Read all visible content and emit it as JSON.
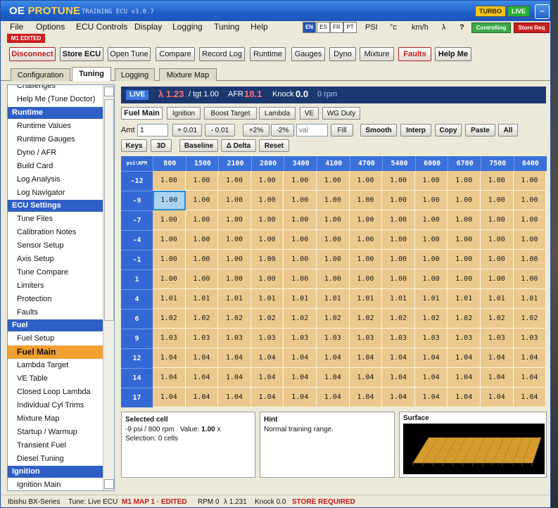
{
  "app": {
    "title_prefix": "OE ",
    "title_brand": "PROTUNE",
    "subtitle": "TRAINING ECU v3.0.7",
    "turbo_badge": "TURBO",
    "live_badge": "LIVE",
    "minimize_glyph": "–"
  },
  "menu": [
    "File",
    "Options",
    "ECU Controls",
    "Display",
    "Logging",
    "Tuning",
    "Help"
  ],
  "languages": [
    {
      "code": "EN",
      "active": true
    },
    {
      "code": "ES",
      "active": false
    },
    {
      "code": "FR",
      "active": false
    },
    {
      "code": "PT",
      "active": false
    }
  ],
  "units": {
    "pressure": "PSI",
    "temp": "°c",
    "speed": "km/h",
    "lambda": "λ",
    "help": "?"
  },
  "status_badges": {
    "controlling": "Controlling",
    "store_req": "Store Req",
    "map_edited": "M1 EDITED"
  },
  "toolbar": [
    "Disconnect",
    "Store ECU",
    "Open Tune",
    "Compare",
    "Record Log",
    "Runtime",
    "Gauges",
    "Dyno",
    "Mixture",
    "Faults",
    "Help Me"
  ],
  "tabs": [
    "Configuration",
    "Tuning",
    "Logging",
    "Mixture Map"
  ],
  "active_tab": "Tuning",
  "sidebar": {
    "top_items": [
      "Challenges",
      "Help Me (Tune Doctor)"
    ],
    "sections": [
      {
        "header": "Runtime",
        "items": [
          "Runtime Values",
          "Runtime Gauges",
          "Dyno / AFR",
          "Build Card",
          "Log Analysis",
          "Log Navigator"
        ]
      },
      {
        "header": "ECU Settings",
        "items": [
          "Tune Files",
          "Calibration Notes",
          "Sensor Setup",
          "Axis Setup",
          "Tune Compare",
          "Limiters",
          "Protection",
          "Faults"
        ]
      },
      {
        "header": "Fuel",
        "items": [
          "Fuel Setup",
          "Fuel Main",
          "Lambda Target",
          "VE Table",
          "Closed Loop Lambda",
          "Individual Cyl Trims",
          "Mixture Map",
          "Startup / Warmup",
          "Transient Fuel",
          "Diesel Tuning"
        ]
      },
      {
        "header": "Ignition",
        "items": [
          "Ignition Main"
        ]
      }
    ],
    "selected": "Fuel Main"
  },
  "live": {
    "badge": "LIVE",
    "lambda_symbol": "λ",
    "lambda_value": "1.23",
    "lambda_target": "/ tgt 1.00",
    "afr_label": "AFR",
    "afr_value": "18.1",
    "knock_label": "Knock",
    "knock_value": "0.0",
    "rpm": "0 rpm"
  },
  "subtabs": [
    "Fuel Main",
    "Ignition",
    "Boost Target",
    "Lambda",
    "VE",
    "WG Duty"
  ],
  "controls": {
    "amt_label": "Amt",
    "amt_value": "1",
    "val_placeholder": "val",
    "row1": [
      "+ 0.01",
      "- 0.01",
      "+2%",
      "-2%",
      "Fill",
      "Smooth",
      "Interp",
      "Copy",
      "Paste",
      "All"
    ],
    "row2": [
      "Keys",
      "3D",
      "Baseline",
      "Δ Delta",
      "Reset"
    ]
  },
  "table": {
    "corner": "psi\\RPM",
    "rpm": [
      "800",
      "1500",
      "2100",
      "2800",
      "3400",
      "4100",
      "4700",
      "5400",
      "6000",
      "6700",
      "7500",
      "8400"
    ],
    "psi": [
      "-12",
      "-9",
      "-7",
      "-4",
      "-1",
      "1",
      "4",
      "6",
      "9",
      "12",
      "14",
      "17"
    ],
    "values": [
      [
        "1.00",
        "1.00",
        "1.00",
        "1.00",
        "1.00",
        "1.00",
        "1.00",
        "1.00",
        "1.00",
        "1.00",
        "1.00",
        "1.00"
      ],
      [
        "1.00",
        "1.00",
        "1.00",
        "1.00",
        "1.00",
        "1.00",
        "1.00",
        "1.00",
        "1.00",
        "1.00",
        "1.00",
        "1.00"
      ],
      [
        "1.00",
        "1.00",
        "1.00",
        "1.00",
        "1.00",
        "1.00",
        "1.00",
        "1.00",
        "1.00",
        "1.00",
        "1.00",
        "1.00"
      ],
      [
        "1.00",
        "1.00",
        "1.00",
        "1.00",
        "1.00",
        "1.00",
        "1.00",
        "1.00",
        "1.00",
        "1.00",
        "1.00",
        "1.00"
      ],
      [
        "1.00",
        "1.00",
        "1.00",
        "1.00",
        "1.00",
        "1.00",
        "1.00",
        "1.00",
        "1.00",
        "1.00",
        "1.00",
        "1.00"
      ],
      [
        "1.00",
        "1.00",
        "1.00",
        "1.00",
        "1.00",
        "1.00",
        "1.00",
        "1.00",
        "1.00",
        "1.00",
        "1.00",
        "1.00"
      ],
      [
        "1.01",
        "1.01",
        "1.01",
        "1.01",
        "1.01",
        "1.01",
        "1.01",
        "1.01",
        "1.01",
        "1.01",
        "1.01",
        "1.01"
      ],
      [
        "1.02",
        "1.02",
        "1.02",
        "1.02",
        "1.02",
        "1.02",
        "1.02",
        "1.02",
        "1.02",
        "1.02",
        "1.02",
        "1.02"
      ],
      [
        "1.03",
        "1.03",
        "1.03",
        "1.03",
        "1.03",
        "1.03",
        "1.03",
        "1.03",
        "1.03",
        "1.03",
        "1.03",
        "1.03"
      ],
      [
        "1.04",
        "1.04",
        "1.04",
        "1.04",
        "1.04",
        "1.04",
        "1.04",
        "1.04",
        "1.04",
        "1.04",
        "1.04",
        "1.04"
      ],
      [
        "1.04",
        "1.04",
        "1.04",
        "1.04",
        "1.04",
        "1.04",
        "1.04",
        "1.04",
        "1.04",
        "1.04",
        "1.04",
        "1.04"
      ],
      [
        "1.04",
        "1.04",
        "1.04",
        "1.04",
        "1.04",
        "1.04",
        "1.04",
        "1.04",
        "1.04",
        "1.04",
        "1.04",
        "1.04"
      ]
    ],
    "selected_row": 1,
    "selected_col": 0,
    "cell_color": "#ebc98d",
    "header_color": "#3a70da"
  },
  "selected_cell": {
    "title": "Selected cell",
    "position": "-9 psi / 800 rpm",
    "value_label": "Value:",
    "value": "1.00",
    "value_unit": "x",
    "selection": "Selection: 0 cells"
  },
  "hint": {
    "title": "Hint",
    "text": "Normal training range."
  },
  "surface": {
    "title": "Surface",
    "color": "#e0a532"
  },
  "statusbar": {
    "car": "Ibishu BX-Series",
    "tune": "Tune: Live ECU",
    "map": "M1 MAP 1 · EDITED",
    "rpm": "RPM 0",
    "lambda": "λ 1.231",
    "knock": "Knock 0.0",
    "store": "STORE REQUIRED"
  }
}
